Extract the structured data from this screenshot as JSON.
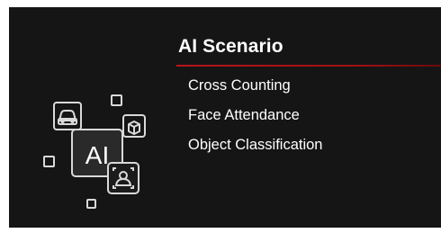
{
  "logo": {
    "icon": "ai-chip-icon",
    "text": "AI",
    "stroke_color": "#d9d9d9",
    "face_color": "#2a2a2a"
  },
  "menu": {
    "title": "AI Scenario",
    "accent_color": "#b8151a",
    "items": [
      {
        "label": "Cross Counting"
      },
      {
        "label": "Face Attendance"
      },
      {
        "label": "Object Classification"
      }
    ]
  }
}
